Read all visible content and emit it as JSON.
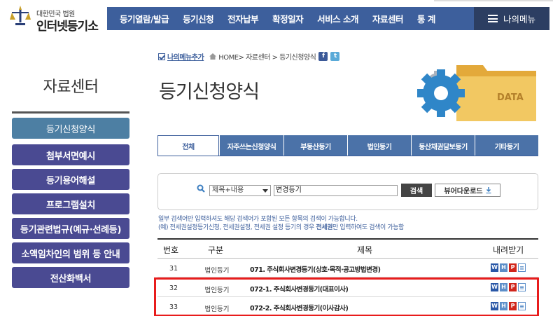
{
  "header": {
    "logo_small": "대한민국 법원",
    "logo_big": "인터넷등기소",
    "nav": [
      "등기열람/발급",
      "등기신청",
      "전자납부",
      "확정일자",
      "서비스 소개",
      "자료센터",
      "통 계"
    ],
    "my_menu": "나의메뉴"
  },
  "sidebar": {
    "title": "자료센터",
    "items": [
      {
        "label": "등기신청양식"
      },
      {
        "label": "첨부서면예시"
      },
      {
        "label": "등기용어해설"
      },
      {
        "label": "프로그램설치"
      },
      {
        "label": "등기관련법규(예규·선례등)"
      },
      {
        "label": "소액임차인의 범위 등 안내"
      },
      {
        "label": "전산화백서"
      }
    ]
  },
  "breadcrumb": {
    "add_menu": "나의메뉴추가",
    "path": "HOME> 자료센터 > 등기신청양식"
  },
  "page_title": "등기신청양식",
  "illustration_text": "DATA",
  "tabs": [
    "전체",
    "자주쓰는신청양식",
    "부동산등기",
    "법인등기",
    "동산채권담보등기",
    "기타등기"
  ],
  "search": {
    "select_value": "제목+내용",
    "input_value": "변경등기",
    "button": "검색",
    "viewer_button": "뷰어다운로드"
  },
  "notice": {
    "line1": "일부 검색어만 입력하셔도 해당 검색어가 포함된 모든 항목의 검색이 가능합니다.",
    "line2_pre": "(예) 전세권설정등기신청, 전세권설정, 전세권 설정 등기의 경우 ",
    "line2_bold": "전세권",
    "line2_post": "만 입력하여도 검색이 가능함"
  },
  "table": {
    "headers": {
      "no": "번호",
      "category": "구분",
      "title": "제목",
      "download": "내려받기"
    },
    "rows": [
      {
        "no": "31",
        "category": "법인등기",
        "title": "071. 주식회사변경등기(상호·목적·공고방법변경)"
      },
      {
        "no": "32",
        "category": "법인등기",
        "title": "072-1. 주식회사변경등기(대표이사)"
      },
      {
        "no": "33",
        "category": "법인등기",
        "title": "072-2. 주식회사변경등기(이사감사)"
      }
    ]
  },
  "colors": {
    "nav_bg": "#3d5f9c",
    "sidebar_bg": "#4a4a92",
    "sidebar_active": "#4d7fa3",
    "highlight": "#e81c1c"
  }
}
